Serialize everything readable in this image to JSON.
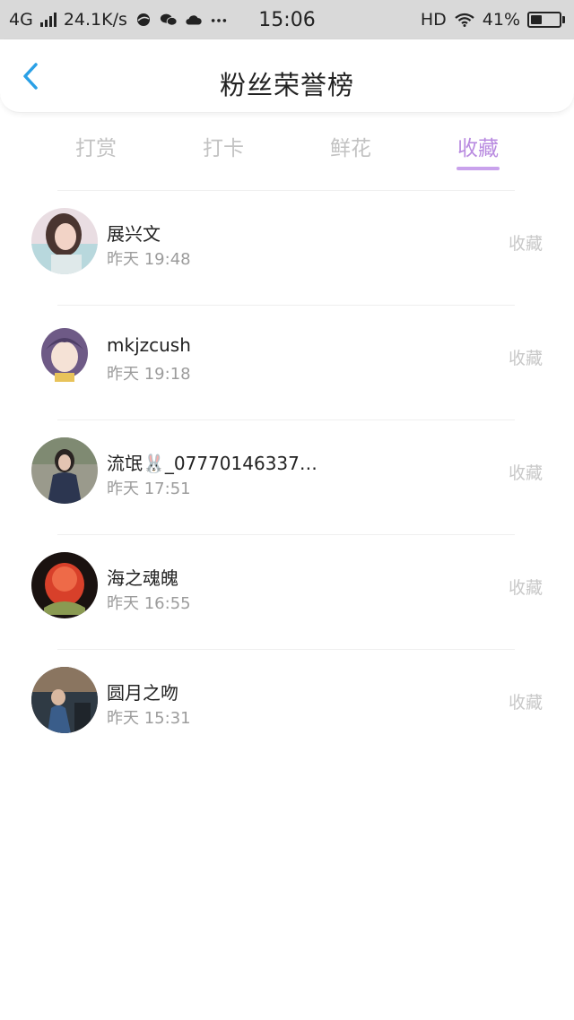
{
  "status_bar": {
    "network": "4G",
    "speed": "24.1K/s",
    "time": "15:06",
    "hd": "HD",
    "battery_level": "41%",
    "battery_fraction": 0.41,
    "icons": [
      "signal-icon",
      "browser-icon",
      "wechat-icon",
      "cloud-icon",
      "more-icon",
      "wifi-icon",
      "battery-icon"
    ]
  },
  "header": {
    "title": "粉丝荣誉榜",
    "back_icon": "chevron-left-icon",
    "accent_color": "#2aa0e6"
  },
  "tabs": [
    {
      "label": "打赏",
      "active": false
    },
    {
      "label": "打卡",
      "active": false
    },
    {
      "label": "鲜花",
      "active": false
    },
    {
      "label": "收藏",
      "active": true
    }
  ],
  "tab_active_color": "#b98be0",
  "fans": [
    {
      "name": "展兴文",
      "time": "昨天 19:48",
      "action": "收藏"
    },
    {
      "name": "mkjzcush",
      "time": "昨天 19:18",
      "action": "收藏"
    },
    {
      "name": "流氓🐰_07770146337…",
      "time": "昨天 17:51",
      "action": "收藏"
    },
    {
      "name": "海之魂魄",
      "time": "昨天 16:55",
      "action": "收藏"
    },
    {
      "name": "圆月之吻",
      "time": "昨天 15:31",
      "action": "收藏"
    }
  ]
}
